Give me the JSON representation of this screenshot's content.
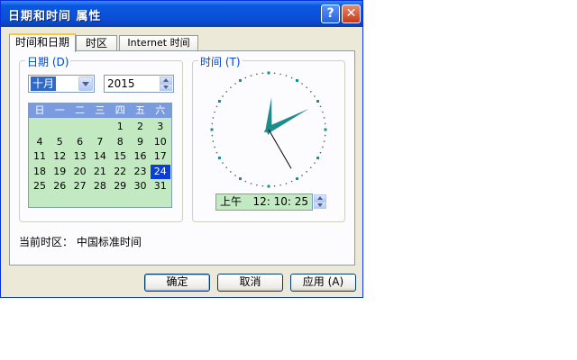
{
  "window": {
    "title": "日期和时间 属性",
    "help_glyph": "?",
    "close_glyph": "✕"
  },
  "tabs": [
    {
      "label": "时间和日期",
      "active": true
    },
    {
      "label": "时区",
      "active": false
    },
    {
      "label": "Internet 时间",
      "active": false
    }
  ],
  "date_group": {
    "label": "日期 (D)",
    "month": "十月",
    "year": "2015",
    "weekdays": [
      "日",
      "一",
      "二",
      "三",
      "四",
      "五",
      "六"
    ],
    "weeks": [
      [
        "",
        "",
        "",
        "",
        "1",
        "2",
        "3"
      ],
      [
        "4",
        "5",
        "6",
        "7",
        "8",
        "9",
        "10"
      ],
      [
        "11",
        "12",
        "13",
        "14",
        "15",
        "16",
        "17"
      ],
      [
        "18",
        "19",
        "20",
        "21",
        "22",
        "23",
        "24"
      ],
      [
        "25",
        "26",
        "27",
        "28",
        "29",
        "30",
        "31"
      ]
    ],
    "selected_day": "24"
  },
  "time_group": {
    "label": "时间 (T)",
    "ampm": "上午",
    "time": "12: 10: 25",
    "clock": {
      "hour": 12,
      "minute": 10,
      "second": 25
    }
  },
  "timezone": {
    "text": "当前时区： 中国标准时间"
  },
  "buttons": {
    "ok": "确定",
    "cancel": "取消",
    "apply": "应用 (A)"
  },
  "colors": {
    "title_bar": "#0a4fd6",
    "calendar_bg": "#c3e9c3",
    "calendar_header": "#7b9be0",
    "selection": "#0a3ed6",
    "clock_hand": "#1c8c8c"
  },
  "icons": [
    "help-icon",
    "close-icon",
    "chevron-down-icon"
  ]
}
